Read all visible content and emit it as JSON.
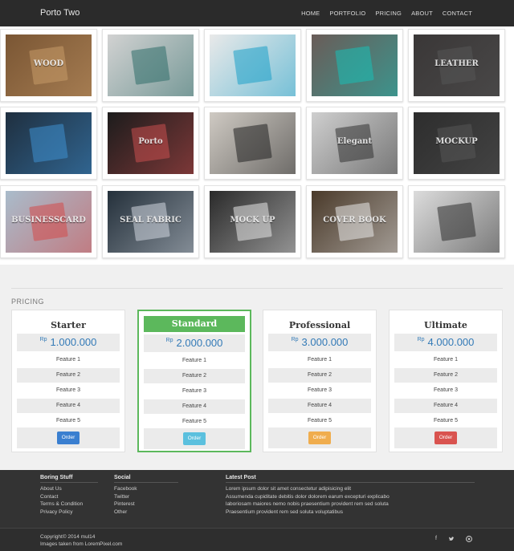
{
  "nav": {
    "brand": "Porto Two",
    "items": [
      "HOME",
      "PORTFOLIO",
      "PRICING",
      "ABOUT",
      "CONTACT"
    ]
  },
  "gallery": {
    "tiles": [
      {
        "name": "wood-3d-letters",
        "bg": "#7a5634",
        "accent": "#c79a68",
        "text": "WOOD"
      },
      {
        "name": "trifold-brochure",
        "bg": "#d2d2d2",
        "accent": "#2f6d6a",
        "text": ""
      },
      {
        "name": "mobile-app-screens",
        "bg": "#e9e9e9",
        "accent": "#1ba0c9",
        "text": ""
      },
      {
        "name": "business-card-colorful",
        "bg": "#6a5c58",
        "accent": "#18c0b6",
        "text": ""
      },
      {
        "name": "leather-emboss",
        "bg": "#3a3737",
        "accent": "#555",
        "text": "LEATHER"
      },
      {
        "name": "tablet-dashboard",
        "bg": "#1f2f3f",
        "accent": "#3e8fd0",
        "text": ""
      },
      {
        "name": "iphone-porto-app",
        "bg": "#1c1c1c",
        "accent": "#c94e4e",
        "text": "Porto"
      },
      {
        "name": "business-cards-bw",
        "bg": "#cfcac3",
        "accent": "#222",
        "text": ""
      },
      {
        "name": "logo-mockup-elegant",
        "bg": "#cfcfcf",
        "accent": "#333",
        "text": "Elegant"
      },
      {
        "name": "black-3d-mockup",
        "bg": "#2d2d2d",
        "accent": "#555",
        "text": "MOCKUP"
      },
      {
        "name": "business-card-stack",
        "bg": "#a9bccb",
        "accent": "#d34a4a",
        "text": "BUSINESSCARD"
      },
      {
        "name": "seal-fabric",
        "bg": "#24303b",
        "accent": "#cfd6de",
        "text": "SEAL FABRIC"
      },
      {
        "name": "cards-mockup-dark",
        "bg": "#2a2a2a",
        "accent": "#e6e6e6",
        "text": "MOCK UP"
      },
      {
        "name": "book-cover-mockup",
        "bg": "#4a3a2a",
        "accent": "#e8e8e8",
        "text": "COVER BOOK"
      },
      {
        "name": "logo-mockup-3d-arrow",
        "bg": "#dcdcdc",
        "accent": "#2f2f2f",
        "text": ""
      }
    ]
  },
  "pricing": {
    "title": "PRICING",
    "currency": "Rp",
    "plans": [
      {
        "name": "Starter",
        "price": "1.000.000",
        "features": [
          "Feature 1",
          "Feature 2",
          "Feature 3",
          "Feature 4",
          "Feature 5"
        ],
        "button": "Order",
        "button_color": "#3a7fd0"
      },
      {
        "name": "Standard",
        "price": "2.000.000",
        "features": [
          "Feature 1",
          "Feature 2",
          "Feature 3",
          "Feature 4",
          "Feature 5"
        ],
        "button": "Order",
        "button_color": "#5bc0de"
      },
      {
        "name": "Professional",
        "price": "3.000.000",
        "features": [
          "Feature 1",
          "Feature 2",
          "Feature 3",
          "Feature 4",
          "Feature 5"
        ],
        "button": "Order",
        "button_color": "#f0ad4e"
      },
      {
        "name": "Ultimate",
        "price": "4.000.000",
        "features": [
          "Feature 1",
          "Feature 2",
          "Feature 3",
          "Feature 4",
          "Feature 5"
        ],
        "button": "Order",
        "button_color": "#d9534f"
      }
    ]
  },
  "footer": {
    "boring": {
      "title": "Boring Stuff",
      "links": [
        "About Us",
        "Contact",
        "Terms & Condition",
        "Privacy Policy"
      ]
    },
    "social": {
      "title": "Social",
      "links": [
        "Facebook",
        "Twitter",
        "Pinterest",
        "Other"
      ]
    },
    "latest": {
      "title": "Latest Post",
      "posts": [
        "Lorem ipsum dolor sit amet consectetur adipisicing elit",
        "Assumenda cupiditate debitis dolor dolorem earum excepturi explicabo",
        "laboriosam maiores nemo nobis praesentium provident rem sed soluta",
        "Praesentium provident rem sed soluta voluptatibus"
      ]
    },
    "copyright": "Copyright© 2014 mul14",
    "images_credit": "Images taken from LoremPixel.com",
    "social_icons": [
      "f",
      "t",
      "gh"
    ]
  }
}
